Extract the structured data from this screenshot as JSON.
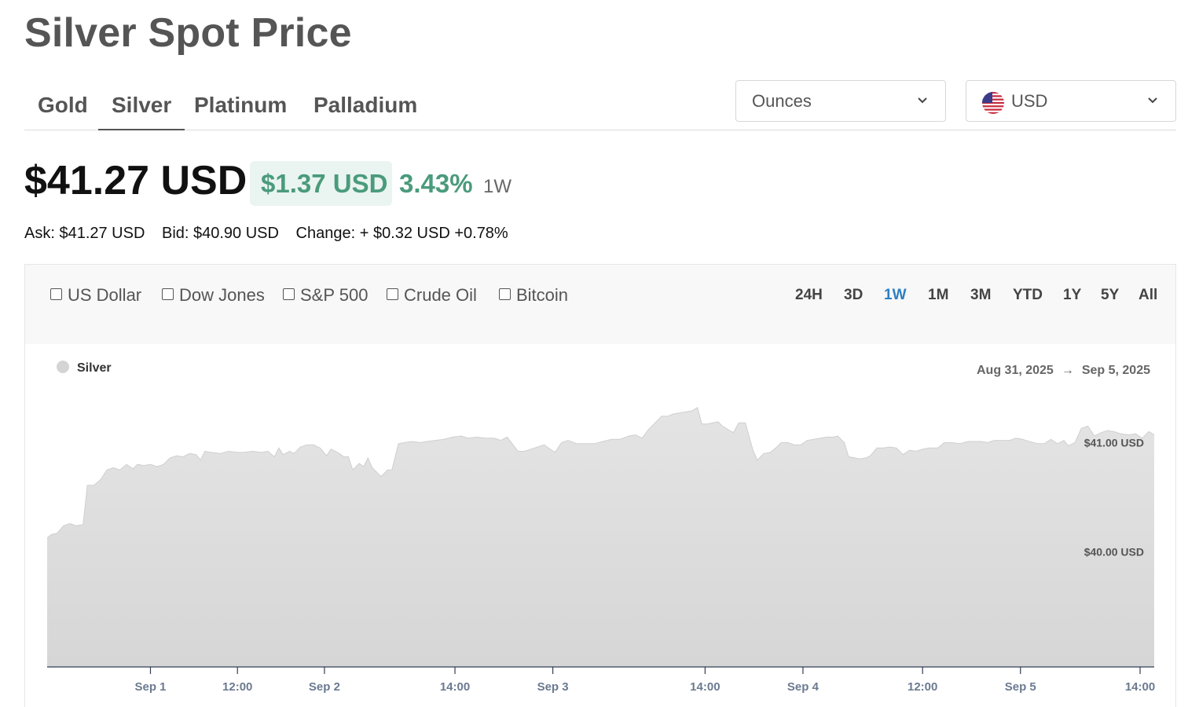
{
  "page": {
    "title": "Silver Spot Price"
  },
  "tabs": [
    {
      "label": "Gold",
      "active": false
    },
    {
      "label": "Silver",
      "active": true
    },
    {
      "label": "Platinum",
      "active": false
    },
    {
      "label": "Palladium",
      "active": false
    }
  ],
  "unit_select": {
    "value": "Ounces",
    "icon": "chevron-down-icon"
  },
  "currency_select": {
    "value": "USD",
    "icon": "us-flag-icon"
  },
  "price": {
    "main": "$41.27 USD",
    "change_amount": "$1.37 USD",
    "change_percent": "3.43%",
    "period": "1W",
    "positive_color": "#4a9b7c"
  },
  "quote": {
    "ask": "Ask: $41.27 USD",
    "bid": "Bid: $40.90 USD",
    "change": "Change: + $0.32 USD +0.78%"
  },
  "compare": [
    {
      "label": "US Dollar",
      "checked": false
    },
    {
      "label": "Dow Jones",
      "checked": false
    },
    {
      "label": "S&P 500",
      "checked": false
    },
    {
      "label": "Crude Oil",
      "checked": false
    },
    {
      "label": "Bitcoin",
      "checked": false
    }
  ],
  "ranges": [
    {
      "label": "24H",
      "active": false
    },
    {
      "label": "3D",
      "active": false
    },
    {
      "label": "1W",
      "active": true
    },
    {
      "label": "1M",
      "active": false
    },
    {
      "label": "3M",
      "active": false
    },
    {
      "label": "YTD",
      "active": false
    },
    {
      "label": "1Y",
      "active": false
    },
    {
      "label": "5Y",
      "active": false
    },
    {
      "label": "All",
      "active": false
    }
  ],
  "accent_color": "#2d7fc4",
  "chart_data": {
    "type": "area",
    "series": [
      {
        "name": "Silver",
        "color": "#d8d8d8"
      }
    ],
    "date_range": {
      "start": "Aug 31, 2025",
      "arrow": "→",
      "end": "Sep 5, 2025"
    },
    "y_ticks": [
      {
        "value": 40.0,
        "label": "$40.00 USD"
      },
      {
        "value": 41.0,
        "label": "$41.00 USD"
      }
    ],
    "ylim": [
      38.95,
      41.62
    ],
    "x_ticks": [
      {
        "t": 0.1,
        "label": "Sep 1"
      },
      {
        "t": 0.5,
        "label": "12:00"
      },
      {
        "t": 0.9,
        "label": "Sep 2"
      },
      {
        "t": 1.5,
        "label": "14:00"
      },
      {
        "t": 1.95,
        "label": "Sep 3"
      },
      {
        "t": 2.65,
        "label": "14:00"
      },
      {
        "t": 3.1,
        "label": "Sep 4"
      },
      {
        "t": 3.65,
        "label": "12:00"
      },
      {
        "t": 4.1,
        "label": "Sep 5"
      },
      {
        "t": 4.65,
        "label": "14:00"
      }
    ],
    "points": [
      [
        -0.375,
        40.13
      ],
      [
        -0.355,
        40.16
      ],
      [
        -0.33,
        40.17
      ],
      [
        -0.3,
        40.24
      ],
      [
        -0.27,
        40.26
      ],
      [
        -0.24,
        40.24
      ],
      [
        -0.21,
        40.25
      ],
      [
        -0.19,
        40.61
      ],
      [
        -0.16,
        40.61
      ],
      [
        -0.13,
        40.66
      ],
      [
        -0.1,
        40.75
      ],
      [
        -0.07,
        40.77
      ],
      [
        -0.04,
        40.75
      ],
      [
        -0.01,
        40.8
      ],
      [
        0.02,
        40.76
      ],
      [
        0.04,
        40.8
      ],
      [
        0.07,
        40.79
      ],
      [
        0.1,
        40.8
      ],
      [
        0.13,
        40.78
      ],
      [
        0.16,
        40.8
      ],
      [
        0.19,
        40.86
      ],
      [
        0.22,
        40.88
      ],
      [
        0.25,
        40.87
      ],
      [
        0.28,
        40.9
      ],
      [
        0.31,
        40.89
      ],
      [
        0.33,
        40.84
      ],
      [
        0.35,
        40.92
      ],
      [
        0.38,
        40.91
      ],
      [
        0.42,
        40.9
      ],
      [
        0.46,
        40.92
      ],
      [
        0.5,
        40.91
      ],
      [
        0.53,
        40.91
      ],
      [
        0.57,
        40.92
      ],
      [
        0.61,
        40.91
      ],
      [
        0.64,
        40.92
      ],
      [
        0.67,
        40.87
      ],
      [
        0.69,
        40.95
      ],
      [
        0.71,
        40.89
      ],
      [
        0.74,
        40.92
      ],
      [
        0.76,
        40.9
      ],
      [
        0.79,
        40.96
      ],
      [
        0.82,
        40.98
      ],
      [
        0.85,
        40.98
      ],
      [
        0.88,
        40.95
      ],
      [
        0.91,
        40.88
      ],
      [
        0.93,
        40.94
      ],
      [
        0.96,
        40.91
      ],
      [
        0.99,
        40.87
      ],
      [
        1.01,
        40.87
      ],
      [
        1.03,
        40.75
      ],
      [
        1.06,
        40.81
      ],
      [
        1.08,
        40.78
      ],
      [
        1.1,
        40.86
      ],
      [
        1.12,
        40.77
      ],
      [
        1.16,
        40.69
      ],
      [
        1.19,
        40.75
      ],
      [
        1.21,
        40.75
      ],
      [
        1.24,
        40.99
      ],
      [
        1.27,
        41.0
      ],
      [
        1.3,
        41.01
      ],
      [
        1.34,
        41.0
      ],
      [
        1.37,
        41.01
      ],
      [
        1.41,
        41.02
      ],
      [
        1.45,
        41.03
      ],
      [
        1.49,
        41.05
      ],
      [
        1.53,
        41.06
      ],
      [
        1.56,
        41.04
      ],
      [
        1.6,
        41.05
      ],
      [
        1.64,
        41.04
      ],
      [
        1.68,
        41.04
      ],
      [
        1.71,
        41.02
      ],
      [
        1.74,
        41.05
      ],
      [
        1.79,
        40.92
      ],
      [
        1.82,
        40.92
      ],
      [
        1.85,
        40.94
      ],
      [
        1.88,
        40.96
      ],
      [
        1.91,
        40.98
      ],
      [
        1.93,
        40.95
      ],
      [
        1.96,
        40.91
      ],
      [
        1.99,
        41.0
      ],
      [
        2.02,
        41.02
      ],
      [
        2.06,
        40.99
      ],
      [
        2.1,
        40.99
      ],
      [
        2.14,
        40.99
      ],
      [
        2.18,
        41.01
      ],
      [
        2.22,
        41.03
      ],
      [
        2.26,
        41.03
      ],
      [
        2.3,
        41.06
      ],
      [
        2.33,
        41.07
      ],
      [
        2.36,
        41.04
      ],
      [
        2.39,
        41.12
      ],
      [
        2.42,
        41.18
      ],
      [
        2.45,
        41.24
      ],
      [
        2.48,
        41.24
      ],
      [
        2.5,
        41.26
      ],
      [
        2.53,
        41.27
      ],
      [
        2.56,
        41.28
      ],
      [
        2.59,
        41.29
      ],
      [
        2.615,
        41.32
      ],
      [
        2.635,
        41.17
      ],
      [
        2.66,
        41.17
      ],
      [
        2.685,
        41.18
      ],
      [
        2.71,
        41.19
      ],
      [
        2.73,
        41.15
      ],
      [
        2.755,
        41.12
      ],
      [
        2.78,
        41.09
      ],
      [
        2.805,
        41.18
      ],
      [
        2.835,
        41.18
      ],
      [
        2.87,
        40.93
      ],
      [
        2.89,
        40.84
      ],
      [
        2.92,
        40.9
      ],
      [
        2.95,
        40.91
      ],
      [
        2.98,
        40.96
      ],
      [
        3.0,
        41.0
      ],
      [
        3.03,
        41.0
      ],
      [
        3.06,
        40.98
      ],
      [
        3.09,
        40.98
      ],
      [
        3.12,
        41.02
      ],
      [
        3.15,
        41.03
      ],
      [
        3.18,
        41.04
      ],
      [
        3.21,
        41.05
      ],
      [
        3.24,
        41.05
      ],
      [
        3.26,
        41.06
      ],
      [
        3.29,
        41.0
      ],
      [
        3.31,
        40.87
      ],
      [
        3.34,
        40.86
      ],
      [
        3.36,
        40.85
      ],
      [
        3.39,
        40.86
      ],
      [
        3.41,
        40.88
      ],
      [
        3.44,
        40.95
      ],
      [
        3.47,
        40.95
      ],
      [
        3.5,
        40.96
      ],
      [
        3.53,
        40.95
      ],
      [
        3.56,
        40.89
      ],
      [
        3.59,
        40.93
      ],
      [
        3.62,
        40.92
      ],
      [
        3.65,
        40.94
      ],
      [
        3.68,
        40.95
      ],
      [
        3.72,
        40.95
      ],
      [
        3.75,
        41.0
      ],
      [
        3.78,
        41.0
      ],
      [
        3.82,
        40.99
      ],
      [
        3.86,
        41.01
      ],
      [
        3.89,
        41.01
      ],
      [
        3.92,
        41.01
      ],
      [
        3.95,
        41.0
      ],
      [
        3.98,
        41.02
      ],
      [
        4.01,
        41.02
      ],
      [
        4.05,
        41.02
      ],
      [
        4.08,
        41.04
      ],
      [
        4.11,
        41.03
      ],
      [
        4.14,
        41.01
      ],
      [
        4.18,
        40.99
      ],
      [
        4.21,
        40.99
      ],
      [
        4.24,
        41.03
      ],
      [
        4.27,
        40.99
      ],
      [
        4.3,
        41.02
      ],
      [
        4.32,
        40.97
      ],
      [
        4.35,
        41.0
      ],
      [
        4.38,
        41.13
      ],
      [
        4.41,
        41.15
      ],
      [
        4.44,
        41.06
      ],
      [
        4.47,
        41.09
      ],
      [
        4.5,
        41.11
      ],
      [
        4.53,
        41.1
      ],
      [
        4.56,
        41.08
      ],
      [
        4.6,
        41.07
      ],
      [
        4.63,
        41.08
      ],
      [
        4.66,
        41.04
      ],
      [
        4.69,
        41.1
      ],
      [
        4.715,
        41.07
      ]
    ]
  }
}
